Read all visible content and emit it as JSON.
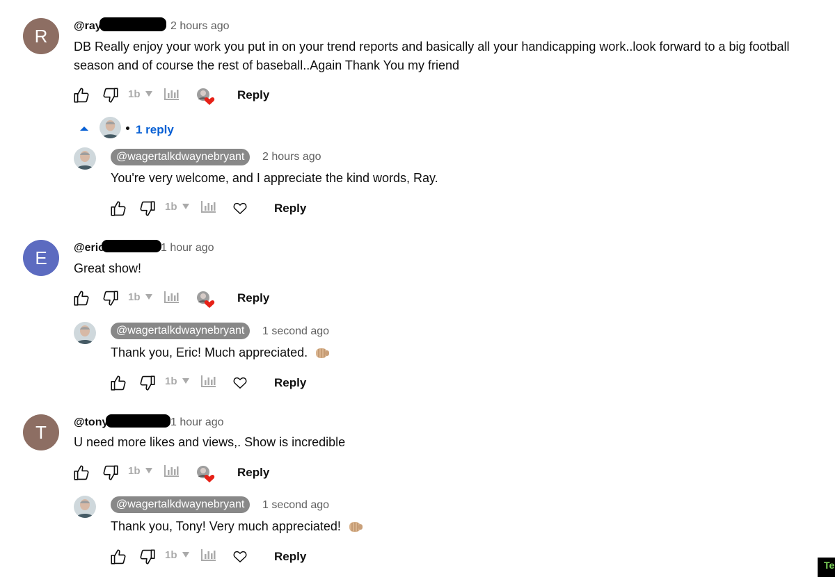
{
  "comments": [
    {
      "avatar_letter": "R",
      "avatar_color": "#8d6e63",
      "handle_prefix": "@ray",
      "time": "2 hours ago",
      "lines": [
        "DB Really enjoy your work you put in on your trend reports and basically all your handicapping work..look forward to a big football",
        "season and of course the rest of baseball..Again Thank You my friend"
      ],
      "reply_label": "Reply",
      "replies_toggle": "1 reply",
      "reply": {
        "handle": "@wagertalkdwaynebryant",
        "time": "2 hours ago",
        "text": "You're very welcome, and I appreciate the kind words, Ray.",
        "reply_label": "Reply"
      }
    },
    {
      "avatar_letter": "E",
      "avatar_color": "#5c6bc0",
      "handle_prefix": "@eric",
      "time": "1 hour ago",
      "lines": [
        "Great show!"
      ],
      "reply_label": "Reply",
      "reply": {
        "handle": "@wagertalkdwaynebryant",
        "time": "1 second ago",
        "text": "Thank you, Eric!  Much appreciated.",
        "reply_label": "Reply"
      }
    },
    {
      "avatar_letter": "T",
      "avatar_color": "#8d6e63",
      "handle_prefix": "@tony",
      "time": "1 hour ago",
      "lines": [
        "U need more likes and views,. Show is incredible"
      ],
      "reply_label": "Reply",
      "reply": {
        "handle": "@wagertalkdwaynebryant",
        "time": "1 second ago",
        "text": "Thank you, Tony!  Very much appreciated!",
        "reply_label": "Reply"
      }
    }
  ],
  "corner_badge": "Te",
  "colors": {
    "accent_blue": "#065fd4",
    "heart_red": "#e62117",
    "handle_chip": "#888888",
    "muted_icon": "#aaaaaa"
  },
  "icons": [
    "thumbs-up-icon",
    "thumbs-down-icon",
    "tubebuddy-icon",
    "analytics-icon",
    "creator-heart-icon",
    "heart-outline-icon",
    "chevron-up-icon",
    "fist-bump-emoji"
  ]
}
